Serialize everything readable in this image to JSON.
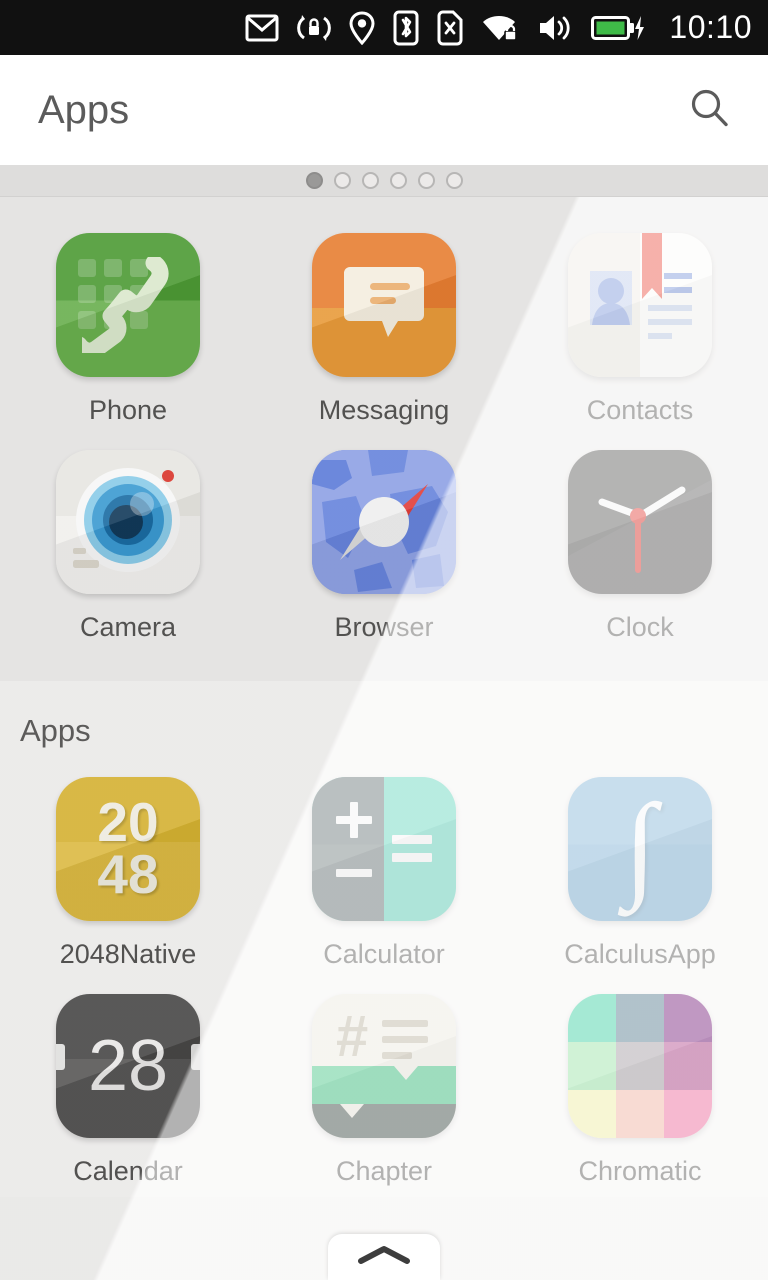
{
  "statusbar": {
    "time": "10:10",
    "icons": [
      {
        "name": "mail-icon"
      },
      {
        "name": "rotation-lock-icon"
      },
      {
        "name": "location-icon"
      },
      {
        "name": "bluetooth-icon"
      },
      {
        "name": "sim-missing-icon"
      },
      {
        "name": "wifi-secure-icon"
      },
      {
        "name": "volume-icon"
      },
      {
        "name": "battery-charging-icon"
      }
    ],
    "battery_color": "#3fbb48",
    "background": "#111111"
  },
  "header": {
    "title": "Apps",
    "search_icon": "search-icon"
  },
  "pager": {
    "count": 6,
    "active_index": 0
  },
  "sections": [
    {
      "title": "",
      "apps": [
        {
          "name": "Phone",
          "icon": "phone-icon"
        },
        {
          "name": "Messaging",
          "icon": "messaging-icon"
        },
        {
          "name": "Contacts",
          "icon": "contacts-icon"
        },
        {
          "name": "Camera",
          "icon": "camera-icon"
        },
        {
          "name": "Browser",
          "icon": "browser-icon"
        },
        {
          "name": "Clock",
          "icon": "clock-icon"
        }
      ]
    },
    {
      "title": "Apps",
      "apps": [
        {
          "name": "2048Native",
          "icon": "2048-icon"
        },
        {
          "name": "Calculator",
          "icon": "calculator-icon"
        },
        {
          "name": "CalculusApp",
          "icon": "calculus-icon"
        },
        {
          "name": "Calendar",
          "icon": "calendar-icon"
        },
        {
          "name": "Chapter",
          "icon": "chapter-icon"
        },
        {
          "name": "Chromatic",
          "icon": "chromatic-icon"
        }
      ]
    }
  ],
  "icon_text": {
    "2048_top": "20",
    "2048_bottom": "48",
    "calculus_symbol": "∫",
    "calendar_day": "28",
    "chapter_hash": "#"
  },
  "chromatic_colors": [
    "#21c995",
    "#3f6a7f",
    "#630069",
    "#8adf9b",
    "#968f94",
    "#a8327f",
    "#faf7a8",
    "#fcb9a6",
    "#f9699f"
  ],
  "bottom_handle": {
    "icon": "chevron-up-icon"
  }
}
